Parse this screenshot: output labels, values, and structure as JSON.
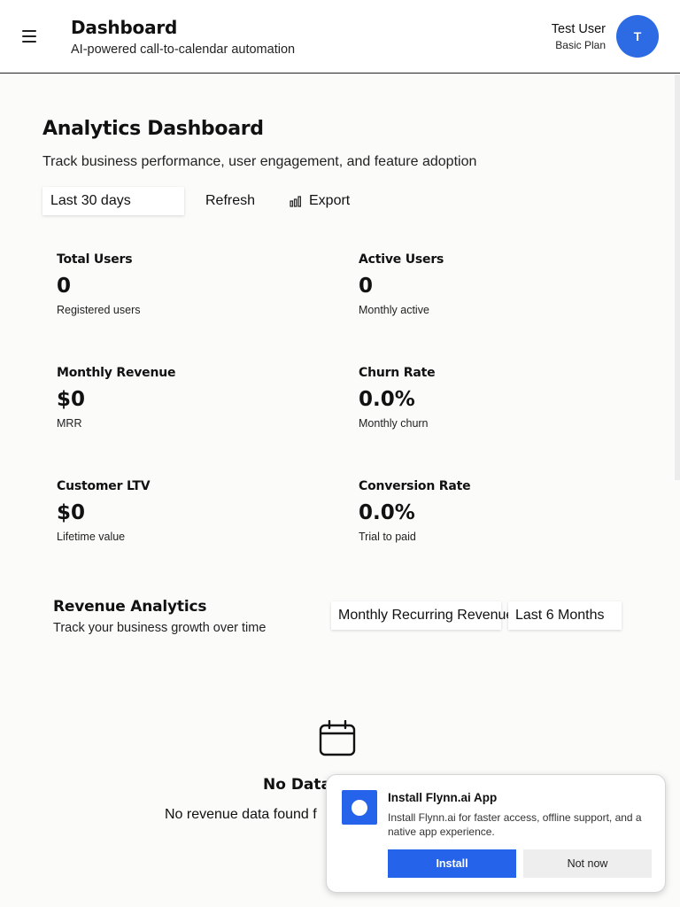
{
  "header": {
    "title": "Dashboard",
    "subtitle": "AI-powered call-to-calendar automation",
    "user_name": "Test User",
    "user_plan": "Basic Plan",
    "avatar_initial": "T",
    "menu_icon": "hamburger-menu-icon"
  },
  "page": {
    "title": "Analytics Dashboard",
    "subtitle": "Track business performance, user engagement, and feature adoption"
  },
  "toolbar": {
    "date_range": "Last 30 days",
    "refresh_label": "Refresh",
    "export_label": "Export",
    "export_icon": "bar-chart-icon"
  },
  "stats": [
    {
      "label": "Total Users",
      "value": "0",
      "note": "Registered users"
    },
    {
      "label": "Active Users",
      "value": "0",
      "note": "Monthly active"
    },
    {
      "label": "Monthly Revenue",
      "value": "$0",
      "note": "MRR"
    },
    {
      "label": "Churn Rate",
      "value": "0.0%",
      "note": "Monthly churn"
    },
    {
      "label": "Customer LTV",
      "value": "$0",
      "note": "Lifetime value"
    },
    {
      "label": "Conversion Rate",
      "value": "0.0%",
      "note": "Trial to paid"
    }
  ],
  "revenue": {
    "title": "Revenue Analytics",
    "subtitle": "Track your business growth over time",
    "metric_select": "Monthly Recurring Revenue",
    "period_select": "Last 6 Months",
    "empty_icon": "calendar-icon",
    "empty_title": "No Data",
    "empty_text": "No revenue data found f"
  },
  "install_prompt": {
    "title": "Install Flynn.ai App",
    "description": "Install Flynn.ai for faster access, offline support, and a native app experience.",
    "install_label": "Install",
    "dismiss_label": "Not now"
  },
  "colors": {
    "accent": "#2563eb",
    "avatar": "#2d6be4"
  }
}
